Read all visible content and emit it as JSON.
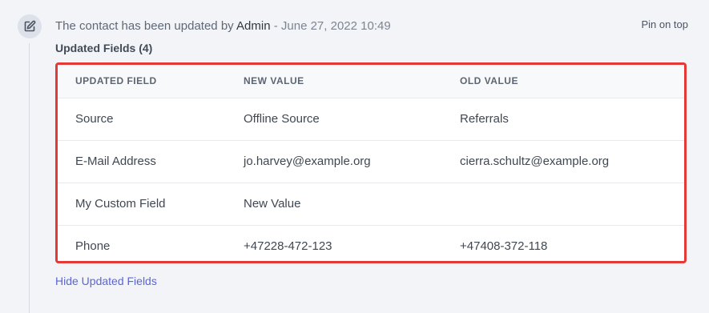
{
  "activity": {
    "icon": "edit-icon",
    "message_prefix": "The contact has been updated by ",
    "author": "Admin",
    "date_separator": " - ",
    "date": "June 27, 2022 10:49",
    "pin_label": "Pin on top"
  },
  "updated_fields": {
    "title": "Updated Fields (4)",
    "columns": [
      "UPDATED FIELD",
      "NEW VALUE",
      "OLD VALUE"
    ],
    "rows": [
      {
        "field": "Source",
        "new_value": "Offline Source",
        "old_value": "Referrals"
      },
      {
        "field": "E-Mail Address",
        "new_value": "jo.harvey@example.org",
        "old_value": "cierra.schultz@example.org"
      },
      {
        "field": "My Custom Field",
        "new_value": "New Value",
        "old_value": ""
      },
      {
        "field": "Phone",
        "new_value": "+47228-472-123",
        "old_value": "+47408-372-118"
      }
    ],
    "toggle_label": "Hide Updated Fields"
  },
  "colors": {
    "background": "#f2f4f8",
    "highlight_border": "#e53935",
    "link": "#5b66d6"
  }
}
